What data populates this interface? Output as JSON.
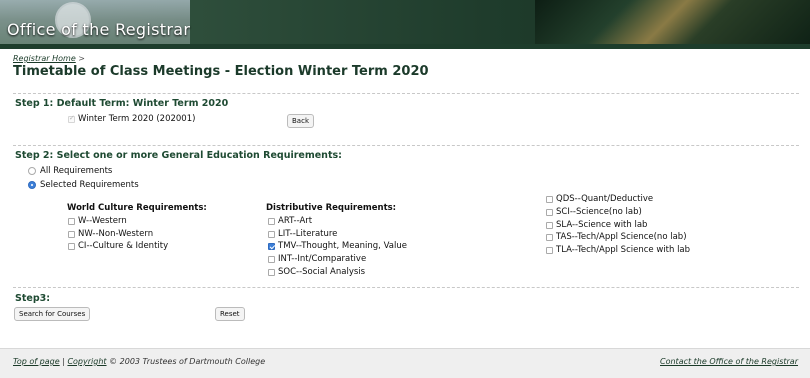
{
  "banner": {
    "brand": "Office of the Registrar"
  },
  "breadcrumb": {
    "home": "Registrar Home",
    "sep": ">"
  },
  "page_title": "Timetable of Class Meetings - Election Winter Term 2020",
  "step1": {
    "heading": "Step 1: Default Term: Winter Term 2020",
    "term_label": "Winter Term 2020 (202001)",
    "back_label": "Back"
  },
  "step2": {
    "heading": "Step 2: Select one or more General Education Requirements:",
    "radio_all": "All Requirements",
    "radio_selected": "Selected Requirements",
    "world_culture": {
      "heading": "World Culture Requirements:",
      "items": [
        {
          "label": "W--Western",
          "checked": false
        },
        {
          "label": "NW--Non-Western",
          "checked": false
        },
        {
          "label": "CI--Culture & Identity",
          "checked": false
        }
      ]
    },
    "distributive": {
      "heading": "Distributive Requirements:",
      "items": [
        {
          "label": "ART--Art",
          "checked": false
        },
        {
          "label": "LIT--Literature",
          "checked": false
        },
        {
          "label": "TMV--Thought, Meaning, Value",
          "checked": true
        },
        {
          "label": "INT--Int/Comparative",
          "checked": false
        },
        {
          "label": "SOC--Social Analysis",
          "checked": false
        }
      ]
    },
    "science": {
      "items": [
        {
          "label": "QDS--Quant/Deductive",
          "checked": false
        },
        {
          "label": "SCI--Science(no lab)",
          "checked": false
        },
        {
          "label": "SLA--Science with lab",
          "checked": false
        },
        {
          "label": "TAS--Tech/Appl Science(no lab)",
          "checked": false
        },
        {
          "label": "TLA--Tech/Appl Science with lab",
          "checked": false
        }
      ]
    }
  },
  "step3": {
    "heading": "Step3:",
    "search_label": "Search for Courses",
    "reset_label": "Reset"
  },
  "footer": {
    "top_of_page": "Top of page",
    "pipe": "|",
    "copyright_link": "Copyright",
    "copyright_text": "© 2003 Trustees of Dartmouth College",
    "contact": "Contact the Office of the Registrar"
  },
  "colors": {
    "heading_green": "#1e4a32",
    "banner_green": "#1e3d2c",
    "check_blue": "#3d7fd8"
  }
}
